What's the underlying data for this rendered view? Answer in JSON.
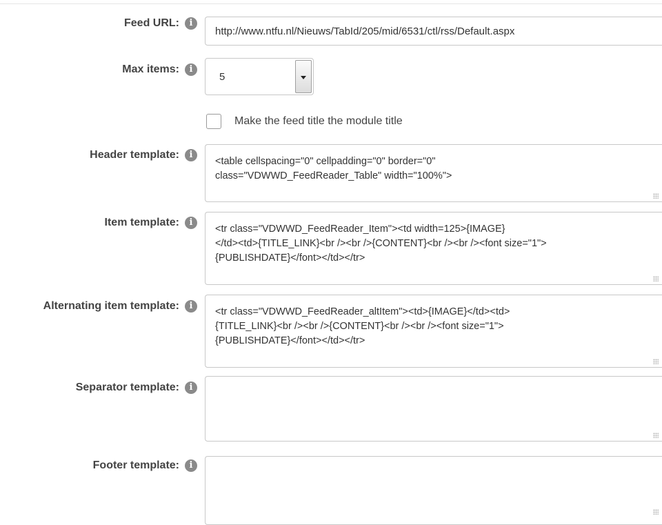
{
  "info_icon_glyph": "i",
  "feed_url": {
    "label": "Feed URL:",
    "value": "http://www.ntfu.nl/Nieuws/TabId/205/mid/6531/ctl/rss/Default.aspx"
  },
  "max_items": {
    "label": "Max items:",
    "selected": "5"
  },
  "feed_title_checkbox": {
    "label": "Make the feed title the module title",
    "checked": false
  },
  "header_template": {
    "label": "Header template:",
    "lines": [
      "<table cellspacing=\"0\" cellpadding=\"0\" border=\"0\"",
      "class=\"VDWWD_FeedReader_Table\" width=\"100%\">"
    ]
  },
  "item_template": {
    "label": "Item template:",
    "lines": [
      "<tr class=\"VDWWD_FeedReader_Item\"><td width=125>{IMAGE}",
      "</td><td>{TITLE_LINK}<br /><br />{CONTENT}<br /><br /><font size=\"1\">",
      "{PUBLISHDATE}</font></td></tr>"
    ]
  },
  "alternating_item_template": {
    "label": "Alternating item template:",
    "lines": [
      "<tr class=\"VDWWD_FeedReader_altItem\"><td>{IMAGE}</td><td>",
      "{TITLE_LINK}<br /><br />{CONTENT}<br /><br /><font size=\"1\">",
      "{PUBLISHDATE}</font></td></tr>"
    ]
  },
  "separator_template": {
    "label": "Separator template:",
    "lines": []
  },
  "footer_template": {
    "label": "Footer template:",
    "lines": []
  }
}
